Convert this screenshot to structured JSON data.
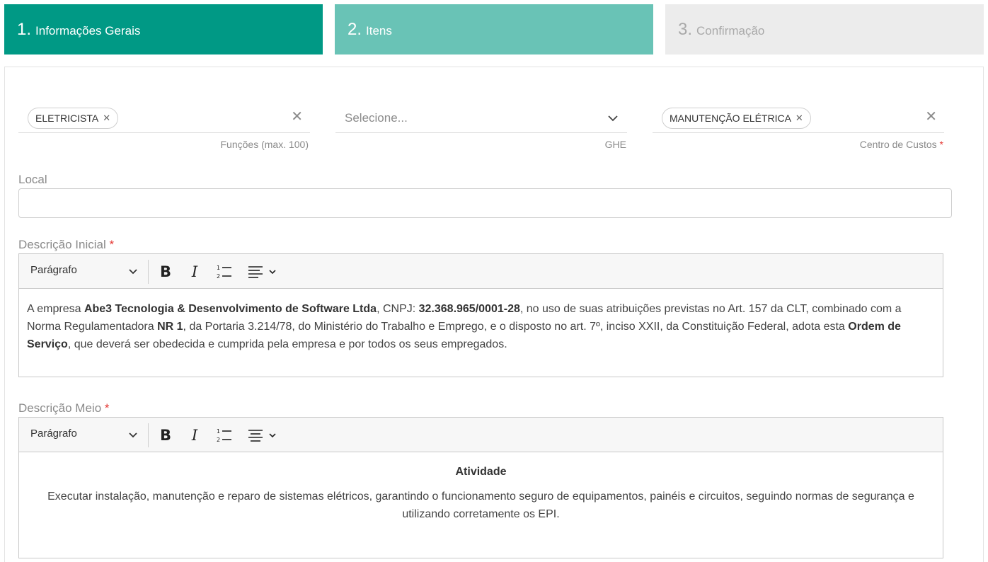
{
  "steps": [
    {
      "num": "1.",
      "label": "Informações Gerais"
    },
    {
      "num": "2.",
      "label": "Itens"
    },
    {
      "num": "3.",
      "label": "Confirmação"
    }
  ],
  "funcoes": {
    "chip": "ELETRICISTA",
    "helper": "Funções (max. 100)"
  },
  "ghe": {
    "placeholder": "Selecione...",
    "helper": "GHE"
  },
  "centro_custos": {
    "chip": "MANUTENÇÃO ELÉTRICA",
    "helper": "Centro de Custos",
    "required": "*"
  },
  "local": {
    "label": "Local",
    "value": ""
  },
  "descricao_inicial": {
    "label": "Descrição Inicial",
    "required": "*",
    "format": "Parágrafo",
    "t1": "A empresa ",
    "b1": "Abe3 Tecnologia & Desenvolvimento de Software Ltda",
    "t2": ", CNPJ: ",
    "b2": "32.368.965/0001-28",
    "t3": ", no uso de suas atribuições previstas no Art. 157 da CLT, combinado com a Norma Regulamentadora ",
    "b3": "NR 1",
    "t4": ", da Portaria 3.214/78, do Ministério do Trabalho e Emprego, e o disposto no art. 7º, inciso XXII, da Constituição Federal, adota esta ",
    "b4": "Ordem de Serviço",
    "t5": ", que deverá ser obedecida e cumprida pela empresa e por todos os seus empregados."
  },
  "descricao_meio": {
    "label": "Descrição Meio",
    "required": "*",
    "format": "Parágrafo",
    "heading": "Atividade",
    "text": "Executar instalação, manutenção e reparo de sistemas elétricos, garantindo o funcionamento seguro de equipamentos, painéis e circuitos, seguindo normas de segurança e utilizando corretamente os EPI."
  },
  "icons": {
    "chip_remove": "close-icon",
    "clear": "close-icon",
    "dropdown": "chevron-down-icon",
    "bold": "bold-icon",
    "italic": "italic-icon",
    "list": "numbered-list-icon",
    "align": "align-left-icon"
  },
  "colors": {
    "step_active": "#009985",
    "step_next": "#69c3b6",
    "step_disabled": "#ececec",
    "required": "#e53935"
  }
}
